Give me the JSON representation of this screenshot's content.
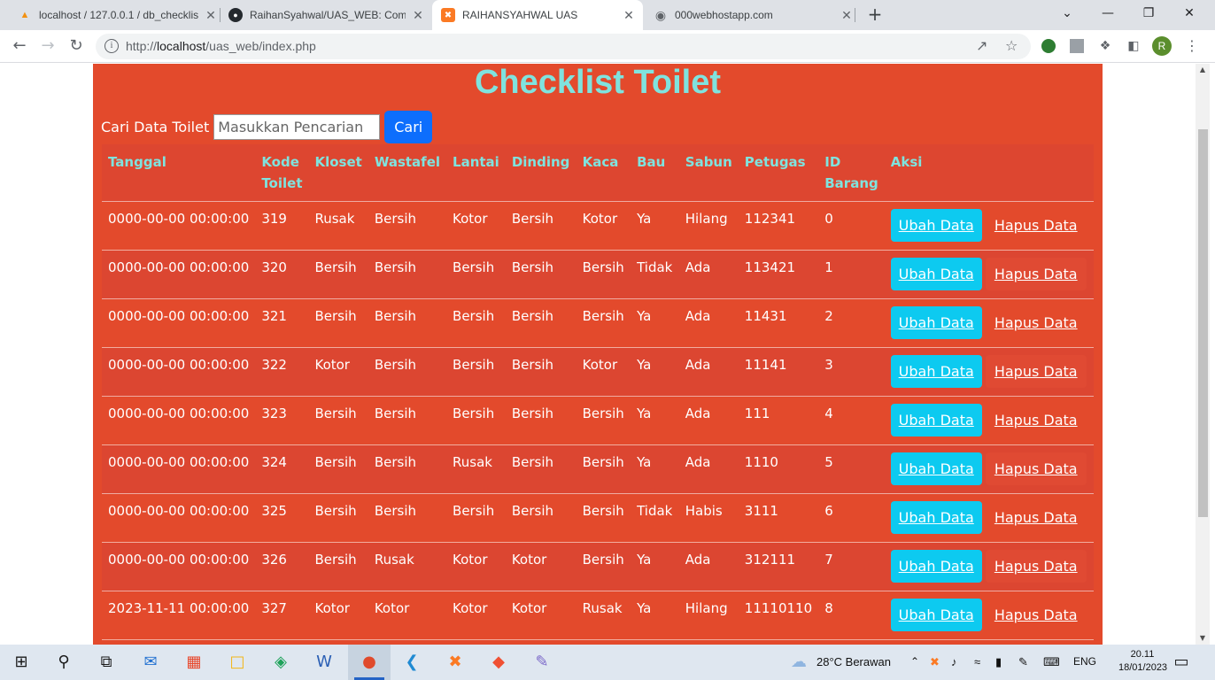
{
  "browser": {
    "tabs": [
      {
        "title": "localhost / 127.0.0.1 / db_checklis",
        "icon": "phpmyadmin-icon"
      },
      {
        "title": "RaihanSyahwal/UAS_WEB: Comin",
        "icon": "github-icon"
      },
      {
        "title": "RAIHANSYAHWAL UAS",
        "icon": "xampp-icon"
      },
      {
        "title": "000webhostapp.com",
        "icon": "globe-icon"
      }
    ],
    "url_prefix": "http://",
    "url_host": "localhost",
    "url_path": "/uas_web/index.php",
    "profile_initial": "R"
  },
  "page": {
    "title": "Checklist Toilet",
    "search_label": "Cari Data Toilet",
    "search_placeholder": "Masukkan Pencarian",
    "search_button": "Cari"
  },
  "table": {
    "headers": [
      "Tanggal",
      "Kode Toilet",
      "Kloset",
      "Wastafel",
      "Lantai",
      "Dinding",
      "Kaca",
      "Bau",
      "Sabun",
      "Petugas",
      "ID Barang",
      "Aksi"
    ],
    "edit_label": "Ubah Data",
    "delete_label": "Hapus Data",
    "rows": [
      [
        "0000-00-00 00:00:00",
        "319",
        "Rusak",
        "Bersih",
        "Kotor",
        "Bersih",
        "Kotor",
        "Ya",
        "Hilang",
        "112341",
        "0"
      ],
      [
        "0000-00-00 00:00:00",
        "320",
        "Bersih",
        "Bersih",
        "Bersih",
        "Bersih",
        "Bersih",
        "Tidak",
        "Ada",
        "113421",
        "1"
      ],
      [
        "0000-00-00 00:00:00",
        "321",
        "Bersih",
        "Bersih",
        "Bersih",
        "Bersih",
        "Bersih",
        "Ya",
        "Ada",
        "11431",
        "2"
      ],
      [
        "0000-00-00 00:00:00",
        "322",
        "Kotor",
        "Bersih",
        "Bersih",
        "Bersih",
        "Kotor",
        "Ya",
        "Ada",
        "11141",
        "3"
      ],
      [
        "0000-00-00 00:00:00",
        "323",
        "Bersih",
        "Bersih",
        "Bersih",
        "Bersih",
        "Bersih",
        "Ya",
        "Ada",
        "111",
        "4"
      ],
      [
        "0000-00-00 00:00:00",
        "324",
        "Bersih",
        "Bersih",
        "Rusak",
        "Bersih",
        "Bersih",
        "Ya",
        "Ada",
        "1110",
        "5"
      ],
      [
        "0000-00-00 00:00:00",
        "325",
        "Bersih",
        "Bersih",
        "Bersih",
        "Bersih",
        "Bersih",
        "Tidak",
        "Habis",
        "3111",
        "6"
      ],
      [
        "0000-00-00 00:00:00",
        "326",
        "Bersih",
        "Rusak",
        "Kotor",
        "Kotor",
        "Bersih",
        "Ya",
        "Ada",
        "312111",
        "7"
      ],
      [
        "2023-11-11 00:00:00",
        "327",
        "Kotor",
        "Kotor",
        "Kotor",
        "Kotor",
        "Rusak",
        "Ya",
        "Hilang",
        "11110110",
        "8"
      ]
    ]
  },
  "taskbar": {
    "weather": "28°C  Berawan",
    "language": "ENG",
    "time": "20.11",
    "date": "18/01/2023"
  },
  "colors": {
    "page_bg": "#e34a2c",
    "title": "#7fe3de",
    "edit_button": "#0dcaf0",
    "search_button": "#0d6efd"
  }
}
